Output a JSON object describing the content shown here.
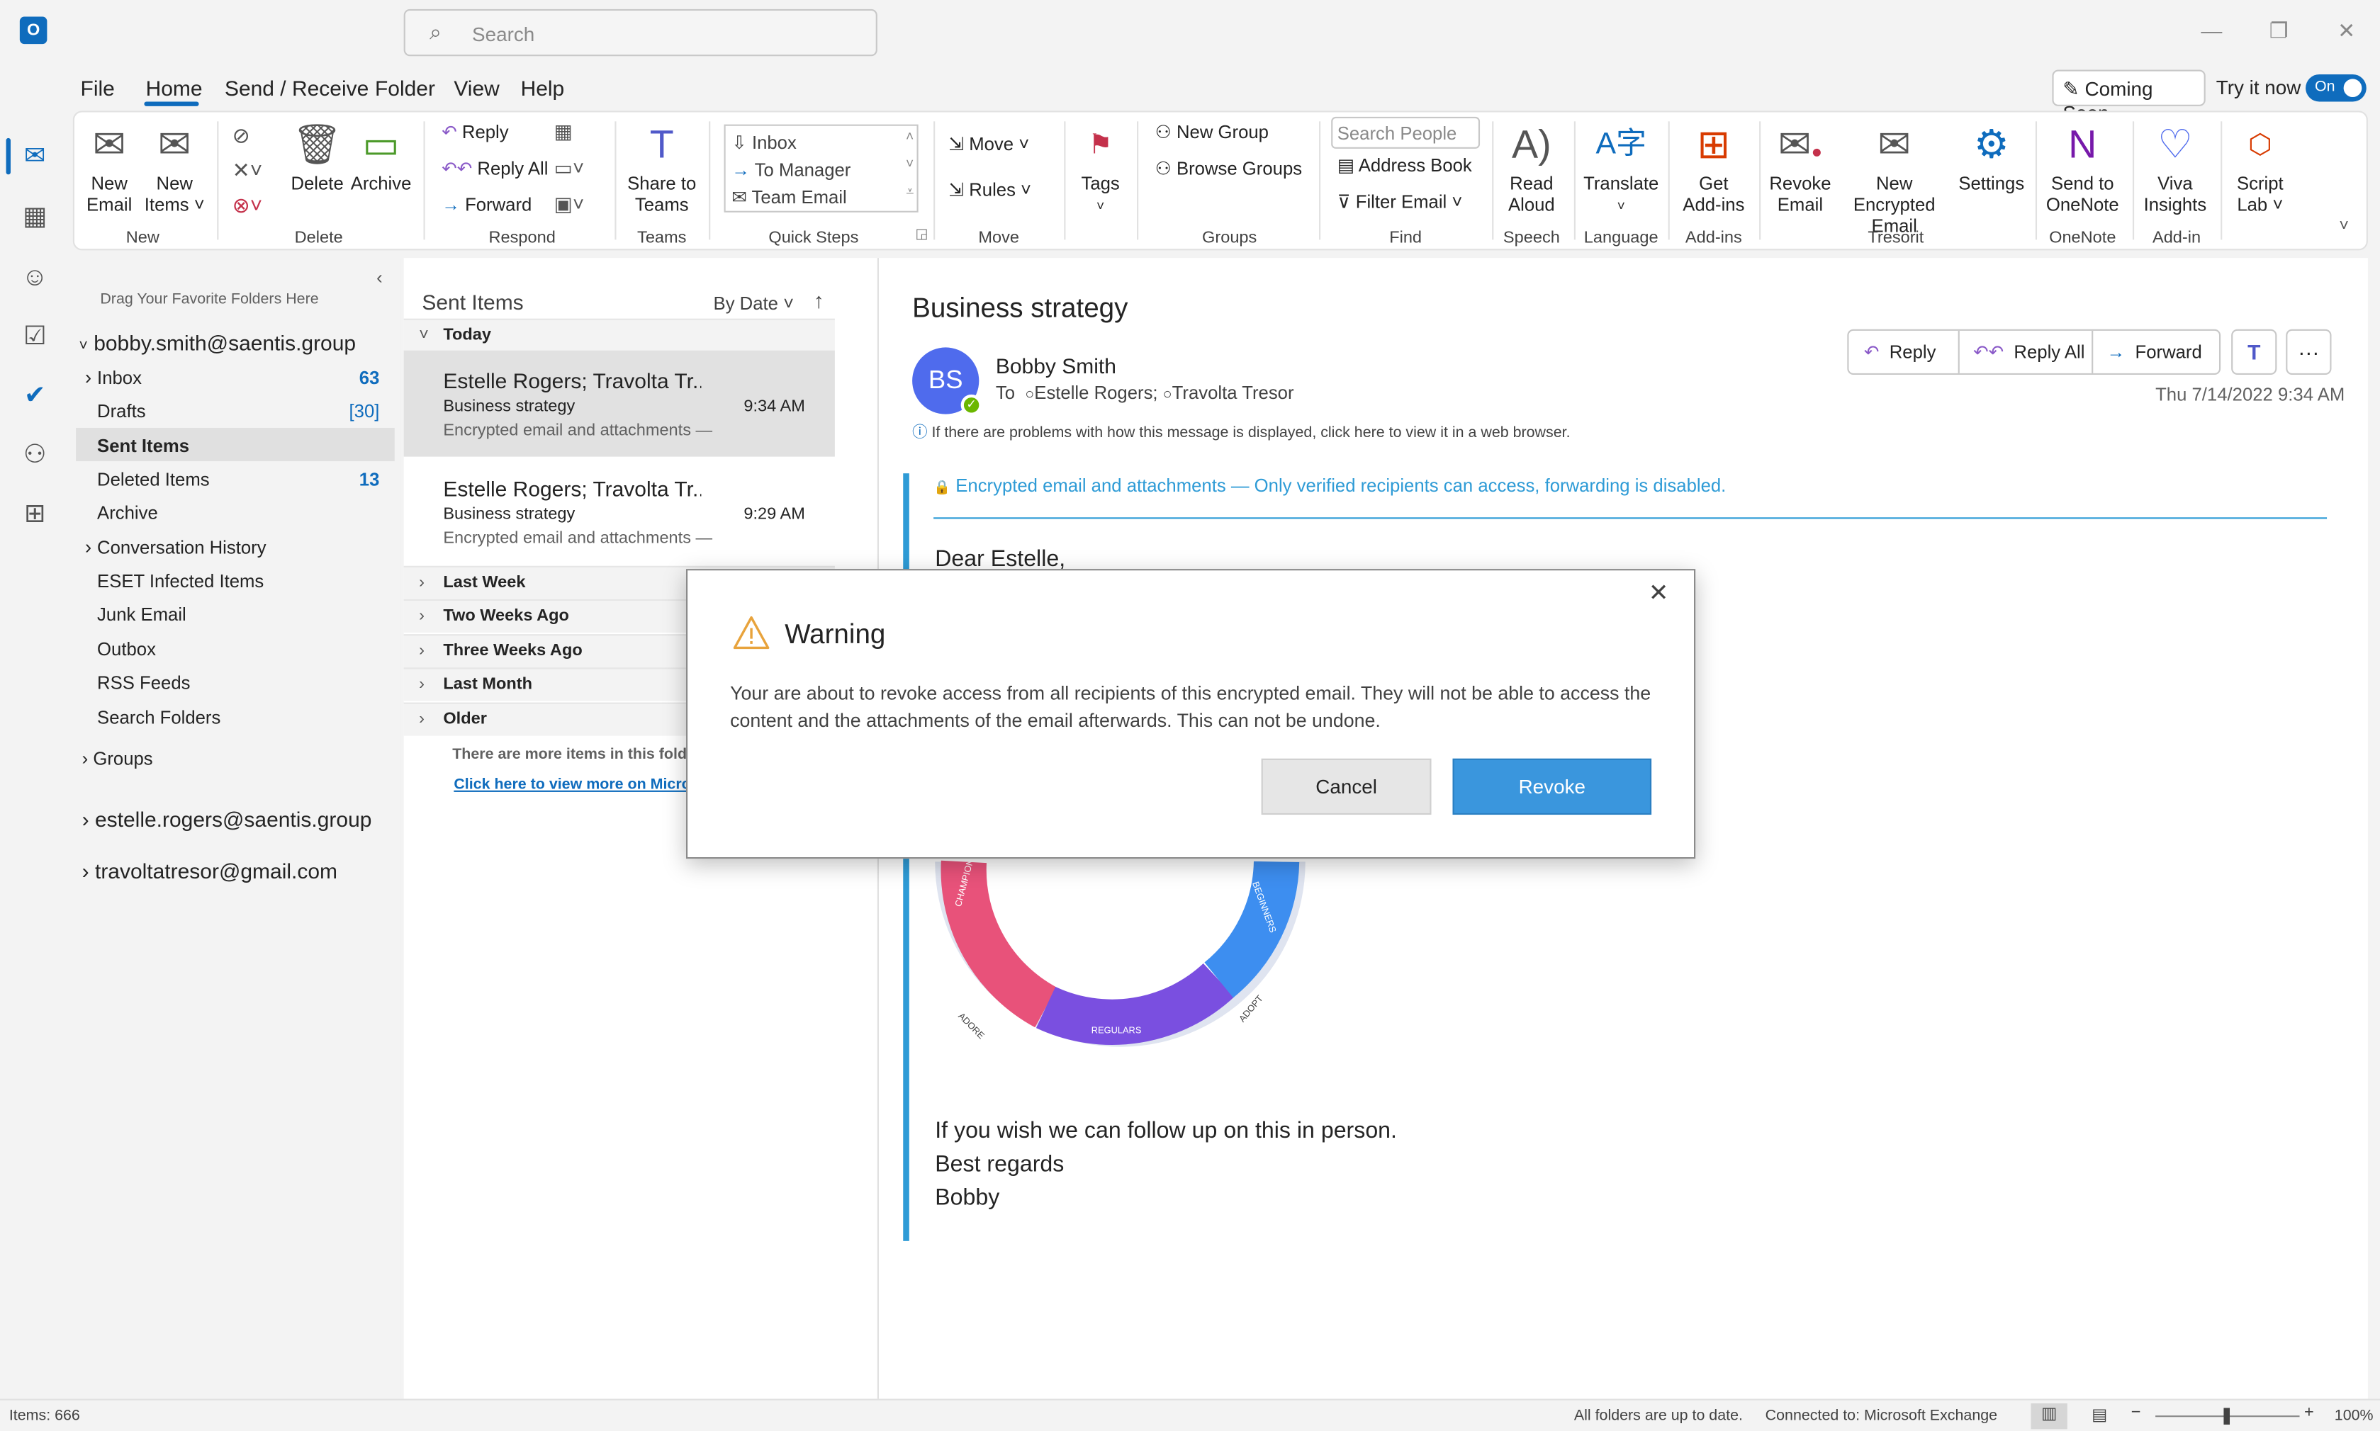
{
  "titlebar": {
    "search_placeholder": "Search"
  },
  "menu": {
    "file": "File",
    "home": "Home",
    "send_receive": "Send / Receive",
    "folder": "Folder",
    "view": "View",
    "help": "Help",
    "coming_soon": "Coming Soon",
    "try_it_now": "Try it now",
    "toggle": "On"
  },
  "ribbon": {
    "new_email_1": "New",
    "new_email_2": "Email",
    "new_items_1": "New",
    "new_items_2": "Items ˅",
    "group_new": "New",
    "delete": "Delete",
    "archive": "Archive",
    "group_delete": "Delete",
    "reply": "Reply",
    "reply_all": "Reply All",
    "forward": "Forward",
    "group_respond": "Respond",
    "share_teams_1": "Share to",
    "share_teams_2": "Teams",
    "group_teams": "Teams",
    "qs_inbox": "Inbox",
    "qs_manager": "To Manager",
    "qs_team": "Team Email",
    "group_quicksteps": "Quick Steps",
    "move": "Move ˅",
    "rules": "Rules ˅",
    "group_move": "Move",
    "tags": "Tags",
    "new_group": "New Group",
    "browse_groups": "Browse Groups",
    "group_groups": "Groups",
    "search_people": "Search People",
    "address_book": "Address Book",
    "filter_email": "Filter Email ˅",
    "group_find": "Find",
    "read_aloud_1": "Read",
    "read_aloud_2": "Aloud",
    "group_speech": "Speech",
    "translate": "Translate",
    "group_language": "Language",
    "get_addins_1": "Get",
    "get_addins_2": "Add-ins",
    "group_addins": "Add-ins",
    "revoke_email_1": "Revoke",
    "revoke_email_2": "Email",
    "new_encrypted_1": "New Encrypted",
    "new_encrypted_2": "Email",
    "settings": "Settings",
    "group_tresorit": "Tresorit",
    "onenote_1": "Send to",
    "onenote_2": "OneNote",
    "group_onenote": "OneNote",
    "viva_1": "Viva",
    "viva_2": "Insights",
    "group_addin": "Add-in",
    "script_1": "Script",
    "script_2": "Lab ˅"
  },
  "folders": {
    "drag_hint": "Drag Your Favorite Folders Here",
    "account_main": "bobby.smith@saentis.group",
    "items": [
      {
        "label": "Inbox",
        "count": "63"
      },
      {
        "label": "Drafts",
        "count": "[30]"
      },
      {
        "label": "Sent Items",
        "count": ""
      },
      {
        "label": "Deleted Items",
        "count": "13"
      },
      {
        "label": "Archive",
        "count": ""
      },
      {
        "label": "Conversation History",
        "count": ""
      },
      {
        "label": "ESET Infected Items",
        "count": ""
      },
      {
        "label": "Junk Email",
        "count": ""
      },
      {
        "label": "Outbox",
        "count": ""
      },
      {
        "label": "RSS Feeds",
        "count": ""
      },
      {
        "label": "Search Folders",
        "count": ""
      }
    ],
    "groups": "Groups",
    "account_2": "estelle.rogers@saentis.group",
    "account_3": "travoltatresor@gmail.com"
  },
  "message_list": {
    "title": "Sent Items",
    "sort": "By Date",
    "today": "Today",
    "messages": [
      {
        "from": "Estelle Rogers; Travolta Tr...",
        "subject": "Business strategy",
        "time": "9:34 AM",
        "preview": "Encrypted email and attachments —"
      },
      {
        "from": "Estelle Rogers; Travolta Tr...",
        "subject": "Business strategy",
        "time": "9:29 AM",
        "preview": "Encrypted email and attachments —"
      }
    ],
    "groups": [
      "Last Week",
      "Two Weeks Ago",
      "Three Weeks Ago",
      "Last Month",
      "Older"
    ],
    "more_items": "There are more items in this folde",
    "view_more": "Click here to view more on Micro"
  },
  "reading": {
    "subject": "Business strategy",
    "avatar": "BS",
    "sender": "Bobby Smith",
    "to_label": "To",
    "recipient_1": "Estelle Rogers;",
    "recipient_2": "Travolta Tresor",
    "date": "Thu 7/14/2022 9:34 AM",
    "reply": "Reply",
    "reply_all": "Reply All",
    "forward": "Forward",
    "info": "If there are problems with how this message is displayed, click here to view it in a web browser.",
    "encrypted_notice": "Encrypted email and attachments — Only verified recipients can access, forwarding is disabled.",
    "greeting": "Dear Estelle,",
    "closing_1": "If you wish we can follow up on this in person.",
    "closing_2": "Best regards",
    "closing_3": "Bobby",
    "diagram_labels": {
      "champions": "CHAMPIONS",
      "beginners": "BEGINNERS",
      "regulars": "REGULARS",
      "adore": "ADORE",
      "adopt": "ADOPT"
    }
  },
  "dialog": {
    "title": "Warning",
    "message": "Your are about to revoke access from all recipients of this encrypted email. They will not be able to access the content and the attachments of the email afterwards. This can not be undone.",
    "cancel": "Cancel",
    "revoke": "Revoke"
  },
  "status": {
    "items": "Items: 666",
    "sync": "All folders are up to date.",
    "connection": "Connected to: Microsoft Exchange",
    "zoom": "100%"
  },
  "colors": {
    "accent": "#0f6cbd",
    "encrypted": "#2e9bd6",
    "revoke": "#3a96dd",
    "warning": "#e8a33c"
  }
}
